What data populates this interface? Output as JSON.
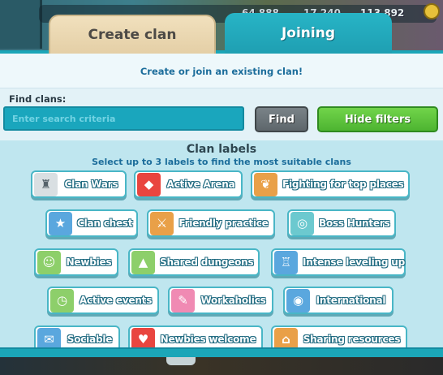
{
  "resources": [
    "64 888",
    "17 240",
    "113 892"
  ],
  "tabs": {
    "create": "Create clan",
    "joining": "Joining"
  },
  "subtitle": "Create or join an existing clan!",
  "search": {
    "label": "Find clans:",
    "placeholder": "Enter search criteria",
    "find_button": "Find",
    "hide_filters_button": "Hide filters"
  },
  "clan_labels": {
    "title": "Clan labels",
    "hint": "Select up to 3 labels to find the most suitable clans",
    "items": [
      {
        "label": "Clan Wars",
        "icon": "castle-tower-icon"
      },
      {
        "label": "Active Arena",
        "icon": "red-gem-icon"
      },
      {
        "label": "Fighting for top places",
        "icon": "laurel-wreath-icon"
      },
      {
        "label": "Clan chest",
        "icon": "star-chest-icon"
      },
      {
        "label": "Friendly practice",
        "icon": "crossed-swords-icon"
      },
      {
        "label": "Boss Hunters",
        "icon": "boss-target-icon"
      },
      {
        "label": "Newbies",
        "icon": "newbie-hero-icon"
      },
      {
        "label": "Shared dungeons",
        "icon": "cave-icon"
      },
      {
        "label": "Intense leveling up",
        "icon": "blue-castle-icon"
      },
      {
        "label": "Active events",
        "icon": "event-clock-icon"
      },
      {
        "label": "Workaholics",
        "icon": "sticky-notes-icon"
      },
      {
        "label": "International",
        "icon": "globe-icon"
      },
      {
        "label": "Sociable",
        "icon": "chat-bubble-icon"
      },
      {
        "label": "Newbies welcome",
        "icon": "heart-icon"
      },
      {
        "label": "Sharing resources",
        "icon": "shared-house-icon"
      }
    ]
  },
  "colors": {
    "accent_teal": "#1ba6b8",
    "find_button": "#6b7378",
    "hide_filters_button": "#5cc23a",
    "heading_blue": "#1c6d9b"
  }
}
